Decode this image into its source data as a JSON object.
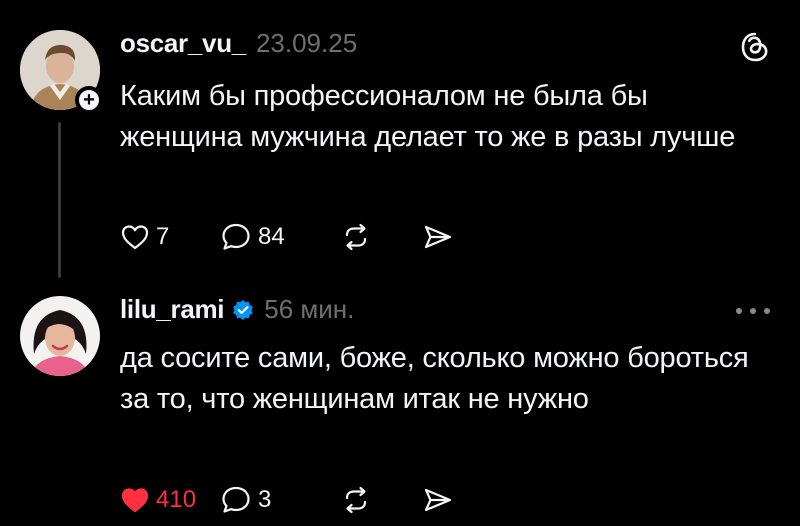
{
  "colors": {
    "background": "#000000",
    "text": "#f3f5f7",
    "muted": "#6f6f6f",
    "like_red": "#ff3040",
    "verified_blue": "#0095f6"
  },
  "posts": [
    {
      "username": "oscar_vu_",
      "timestamp": "23.09.25",
      "text": "Каким бы профессионалом не была бы женщина мужчина делает то же в разы лучше",
      "likes": "7",
      "comments": "84",
      "liked": false,
      "verified": false,
      "has_follow_badge": true,
      "top_right_icon": "threads-logo-icon"
    },
    {
      "username": "lilu_rami",
      "timestamp": "56 мин.",
      "text": "да сосите сами, боже, сколько можно бороться за то, что женщинам итак не нужно",
      "likes": "410",
      "comments": "3",
      "liked": true,
      "verified": true,
      "has_follow_badge": false,
      "top_right_icon": "more-options-icon"
    }
  ]
}
